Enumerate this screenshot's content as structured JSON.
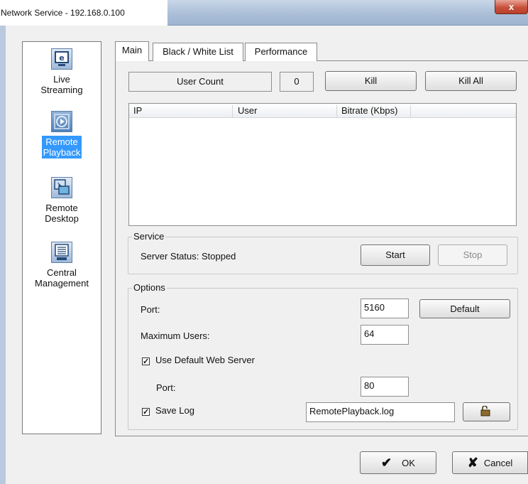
{
  "window": {
    "title": "Network Service - 192.168.0.100",
    "close_glyph": "x"
  },
  "nav": {
    "items": [
      {
        "label_line1": "Live",
        "label_line2": "Streaming",
        "icon": "monitor-icon"
      },
      {
        "label_line1": "Remote",
        "label_line2": "Playback",
        "icon": "playback-icon",
        "selected": true
      },
      {
        "label_line1": "Remote",
        "label_line2": "Desktop",
        "icon": "remote-desktop-icon"
      },
      {
        "label_line1": "Central",
        "label_line2": "Management",
        "icon": "central-management-icon"
      }
    ]
  },
  "tabs": [
    "Main",
    "Black / White List",
    "Performance"
  ],
  "main": {
    "user_count_label": "User Count",
    "user_count_value": "0",
    "kill_label": "Kill",
    "kill_all_label": "Kill All",
    "table_columns": [
      "IP",
      "User",
      "Bitrate (Kbps)"
    ],
    "table_rows": []
  },
  "service": {
    "legend": "Service",
    "status_text": "Server Status: Stopped",
    "start_label": "Start",
    "stop_label": "Stop"
  },
  "options": {
    "legend": "Options",
    "port_label": "Port:",
    "port_value": "5160",
    "default_label": "Default",
    "max_users_label": "Maximum Users:",
    "max_users_value": "64",
    "use_default_web_server_label": "Use Default Web Server",
    "use_default_web_server_checked": true,
    "web_port_label": "Port:",
    "web_port_value": "80",
    "save_log_label": "Save Log",
    "save_log_checked": true,
    "log_file_value": "RemotePlayback.log",
    "open_folder_icon": "folder-open-icon"
  },
  "footer": {
    "ok_label": "OK",
    "cancel_label": "Cancel"
  },
  "colors": {
    "selection": "#3399ff",
    "titlebar": "#a9bdd6",
    "close_button": "#c7503b"
  },
  "check_glyph": "✓"
}
